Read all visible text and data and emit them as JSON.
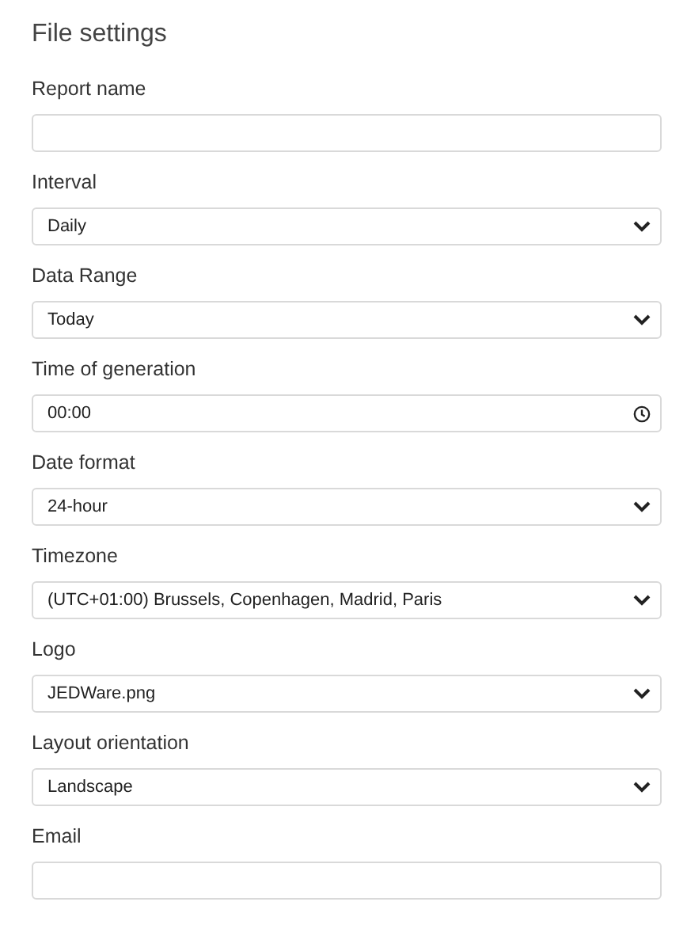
{
  "title": "File settings",
  "fields": [
    {
      "label": "Report name",
      "kind": "text"
    },
    {
      "label": "Interval",
      "kind": "select",
      "value": "Daily"
    },
    {
      "label": "Data Range",
      "kind": "select",
      "value": "Today"
    },
    {
      "label": "Time of generation",
      "kind": "time",
      "value": "00:00"
    },
    {
      "label": "Date format",
      "kind": "select",
      "value": "24-hour"
    },
    {
      "label": "Timezone",
      "kind": "select",
      "value": "(UTC+01:00) Brussels, Copenhagen, Madrid, Paris"
    },
    {
      "label": "Logo",
      "kind": "select",
      "value": "JEDWare.png"
    },
    {
      "label": "Layout orientation",
      "kind": "select",
      "value": "Landscape"
    },
    {
      "label": "Email",
      "kind": "text"
    }
  ]
}
